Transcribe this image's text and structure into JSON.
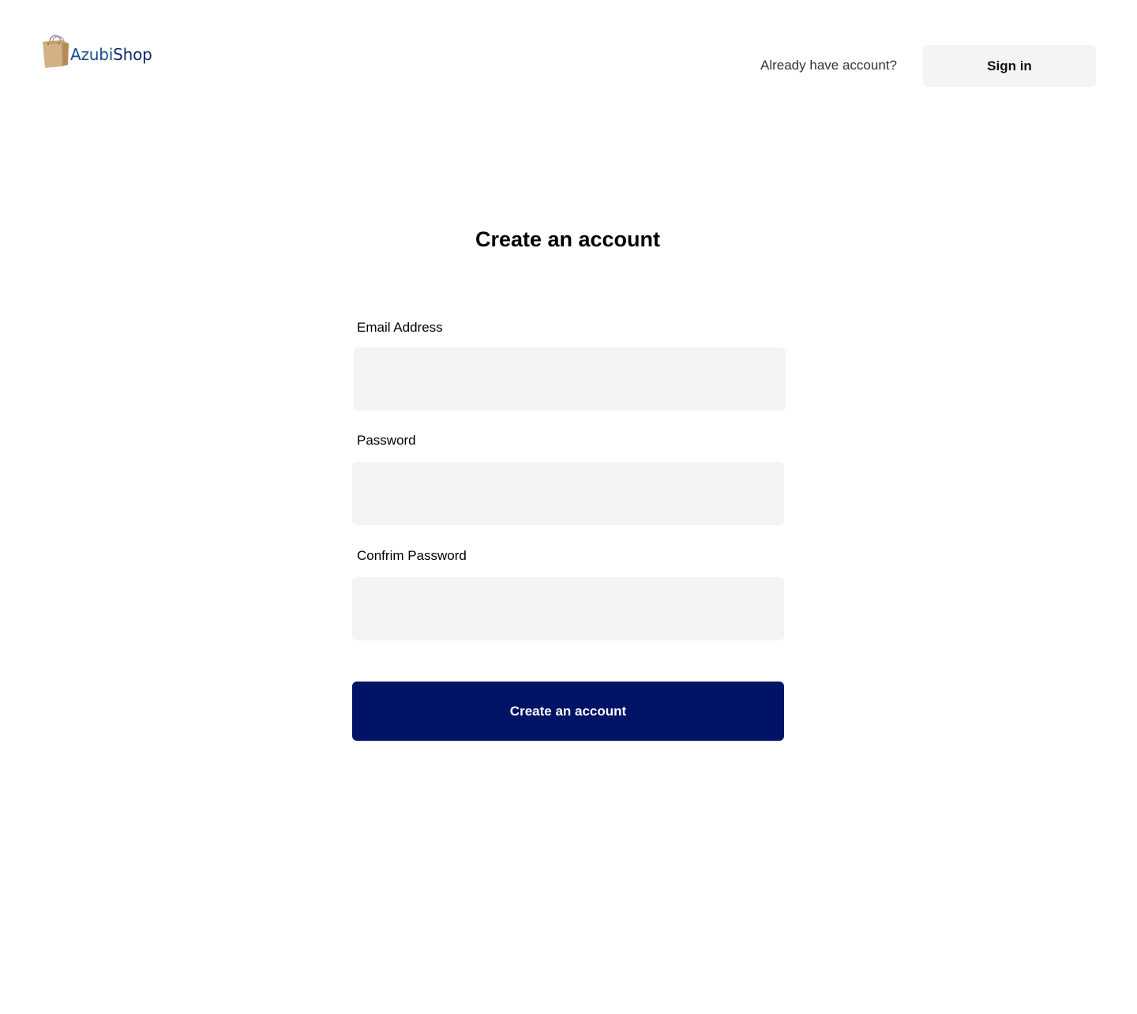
{
  "header": {
    "logo": {
      "icon": "shopping-bag-icon",
      "brand_part1": "Azubi",
      "brand_part2": "Shop"
    },
    "already_text": "Already have account?",
    "signin_label": "Sign in"
  },
  "form": {
    "title": "Create an account",
    "email_label": "Email Address",
    "email_value": "",
    "password_label": "Password",
    "password_value": "",
    "confirm_label": "Confrim Password",
    "confirm_value": "",
    "submit_label": "Create an account"
  },
  "colors": {
    "primary": "#001364",
    "field_bg": "#f4f4f4",
    "logo_azubi": "#1a4e86",
    "logo_shop": "#0e2a6a"
  }
}
